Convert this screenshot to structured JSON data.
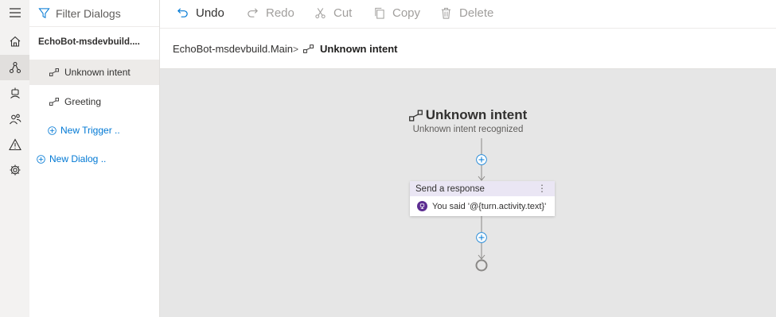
{
  "rail": {
    "items": [
      {
        "icon": "menu-icon"
      },
      {
        "icon": "home-icon"
      },
      {
        "icon": "design-flow-icon",
        "active": true
      },
      {
        "icon": "bot-responses-icon"
      },
      {
        "icon": "users-icon"
      },
      {
        "icon": "warning-icon"
      },
      {
        "icon": "gear-icon"
      }
    ]
  },
  "tree": {
    "filter_label": "Filter Dialogs",
    "bot_name": "EchoBot-msdevbuild....",
    "triggers": [
      {
        "label": "Unknown intent",
        "selected": true
      },
      {
        "label": "Greeting",
        "selected": false
      }
    ],
    "new_trigger_label": "New Trigger ..",
    "new_dialog_label": "New Dialog .."
  },
  "toolbar": {
    "undo_label": "Undo",
    "redo_label": "Redo",
    "cut_label": "Cut",
    "copy_label": "Copy",
    "delete_label": "Delete"
  },
  "breadcrumb": {
    "root": "EchoBot-msdevbuild.Main",
    "separator": ">",
    "current": "Unknown intent"
  },
  "canvas": {
    "trigger_title": "Unknown intent",
    "trigger_subtitle": "Unknown intent recognized",
    "action_card": {
      "header": "Send a response",
      "menu_glyph": "⋮",
      "body": "You said '@{turn.activity.text}'"
    }
  },
  "colors": {
    "accent": "#0078d4",
    "card_header": "#eae6f4",
    "card_icon": "#5c2d91",
    "canvas_bg": "#e6e6e6"
  }
}
